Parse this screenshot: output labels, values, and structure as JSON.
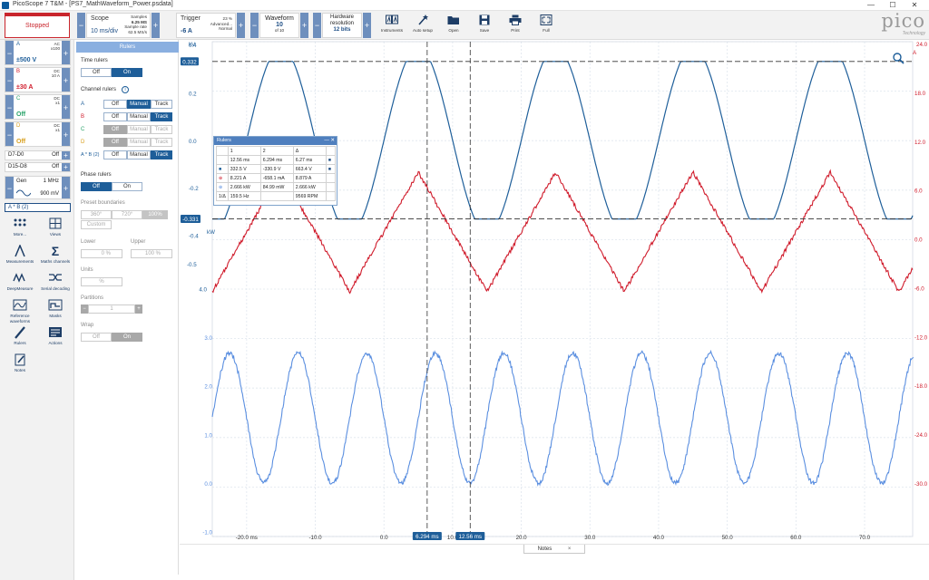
{
  "window": {
    "title": "PicoScope 7 T&M - [PS7_MathWaveform_Power.psdata]",
    "min_icon": "—",
    "max_icon": "☐",
    "close_icon": "✕"
  },
  "toolbar": {
    "status": "Stopped",
    "scope": {
      "label": "Scope",
      "value": "10 ms/div",
      "samples_label": "Samples",
      "samples": "6.25 MS",
      "rate_label": "Sample rate",
      "rate": "62.5 MS/s"
    },
    "trigger": {
      "label": "Trigger",
      "value": "-6 A",
      "pct": "23 %",
      "mode": "Advanced...",
      "type": "Normal"
    },
    "waveform": {
      "label": "Waveform",
      "value": "10",
      "of": "of 10"
    },
    "resolution": {
      "label": "Hardware resolution",
      "value": "12 bits"
    },
    "buttons": [
      "Instruments",
      "Auto setup",
      "Open",
      "Save",
      "Print",
      "Full"
    ],
    "brand": "pico",
    "brand_sub": "Technology"
  },
  "channels": [
    {
      "name": "A",
      "coupling": "AC",
      "probe": "x100",
      "range": "±500 V",
      "color": "#1f5f9a"
    },
    {
      "name": "B",
      "coupling": "DC",
      "probe": "10 A",
      "range": "±30 A",
      "color": "#d01c2c"
    },
    {
      "name": "C",
      "coupling": "DC",
      "probe": "x1",
      "range": "Off",
      "color": "#2aa36a"
    },
    {
      "name": "D",
      "coupling": "DC",
      "probe": "x1",
      "range": "Off",
      "color": "#d8a020"
    }
  ],
  "digital": [
    {
      "name": "D7-D0",
      "state": "Off"
    },
    {
      "name": "D15-D8",
      "state": "Off"
    }
  ],
  "gen": {
    "label": "Gen",
    "freq": "1 MHz",
    "amp": "900 mV"
  },
  "math": "A * B (2)",
  "tools": [
    "More...",
    "Views",
    "Measurements",
    "Maths channels",
    "DeepMeasure",
    "Serial decoding",
    "Reference waveforms",
    "Masks",
    "Rulers",
    "Actions",
    "Notes"
  ],
  "rulers_panel": {
    "title": "Rulers",
    "time_rulers": "Time rulers",
    "channel_rulers": "Channel rulers",
    "phase_rulers": "Phase rulers",
    "preset_boundaries": "Preset boundaries",
    "lower": "Lower",
    "upper": "Upper",
    "units": "Units",
    "partitions": "Partitions",
    "wrap": "Wrap",
    "off": "Off",
    "on": "On",
    "manual": "Manual",
    "track": "Track",
    "p360": "360°",
    "p720": "720°",
    "p100": "100%",
    "custom": "Custom",
    "lower_val": "0 %",
    "upper_val": "100 %",
    "units_val": "%",
    "partitions_val": "1",
    "channel_labels": [
      "A",
      "B",
      "C",
      "D",
      "A * B (2)"
    ]
  },
  "ruler_dialog": {
    "title": "Rulers",
    "headers": [
      "",
      "1",
      "2",
      "Δ",
      ""
    ],
    "rows": [
      [
        "",
        "12.56 ms",
        "6.294 ms",
        "6.27 ms"
      ],
      [
        "■",
        "332.5 V",
        "-330.9 V",
        "663.4 V"
      ],
      [
        "⊕",
        "8.221 A",
        "-658.1 mA",
        "8.879 A"
      ],
      [
        "⊕",
        "2.666 kW",
        "84.99 mW",
        "2.666 kW"
      ],
      [
        "1/Δ",
        "159.5 Hz",
        "",
        "9569 RPM"
      ]
    ]
  },
  "axes": {
    "voltage_label": "kV",
    "voltage_ticks": [
      "0.4",
      "0.2",
      "0.0",
      "-0.2",
      "-0.4"
    ],
    "power_label": "kW",
    "power_ticks": [
      "-0.5",
      "4.0",
      "3.0",
      "2.0",
      "1.0",
      "0.0",
      "-1.0"
    ],
    "current_label": "A",
    "current_ticks": [
      "24.0",
      "18.0",
      "12.0",
      "6.0",
      "0.0",
      "-6.0",
      "-12.0",
      "-18.0",
      "-24.0",
      "-30.0"
    ],
    "time_ticks": [
      "-20.0 ms",
      "-10.0",
      "0.0",
      "10.0",
      "20.0",
      "30.0",
      "40.0",
      "50.0",
      "60.0",
      "70.0"
    ],
    "ruler_v_top": "0.332",
    "ruler_v_bot": "-0.331",
    "time_ruler_1": "6.294 ms",
    "time_ruler_2": "12.56 ms"
  },
  "chart_data": {
    "type": "line",
    "xlabel": "ms",
    "xlim": [
      -25,
      77
    ],
    "series": [
      {
        "name": "A",
        "color": "#1f5f9a",
        "unit": "kV",
        "ylim": [
          -0.44,
          0.4
        ],
        "period_ms": 20,
        "amplitude": 0.332,
        "shape": "clipped-sine"
      },
      {
        "name": "B",
        "color": "#d01c2c",
        "unit": "A",
        "ylim": [
          -30,
          24
        ],
        "period_ms": 20,
        "min": -6.5,
        "max": 8.2,
        "shape": "triangle-noisy"
      },
      {
        "name": "A * B (2)",
        "color": "#5b8fe0",
        "unit": "kW",
        "ylim": [
          -1.0,
          4.0
        ],
        "period_ms": 10,
        "min": 0.0,
        "max": 2.67,
        "shape": "sin-squared-noisy"
      }
    ],
    "time_rulers_ms": [
      6.294,
      12.56
    ],
    "voltage_rulers_kV": [
      0.332,
      -0.331
    ]
  }
}
